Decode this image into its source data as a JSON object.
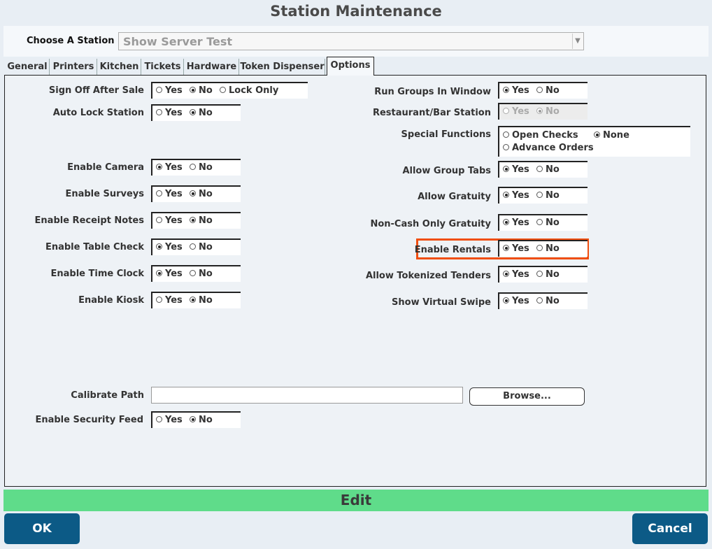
{
  "window": {
    "title": "Station Maintenance"
  },
  "station": {
    "label": "Choose A Station",
    "value": "Show Server Test"
  },
  "tabs": [
    {
      "label": "General"
    },
    {
      "label": "Printers"
    },
    {
      "label": "Kitchen"
    },
    {
      "label": "Tickets"
    },
    {
      "label": "Hardware"
    },
    {
      "label": "Token Dispenser"
    },
    {
      "label": "Options",
      "active": true
    }
  ],
  "left_settings": [
    {
      "label": "Sign Off After Sale",
      "options": [
        "Yes",
        "No",
        "Lock Only"
      ],
      "selected": "No"
    },
    {
      "label": "Auto Lock Station",
      "options": [
        "Yes",
        "No"
      ],
      "selected": "No"
    },
    {
      "label": "Enable Camera",
      "options": [
        "Yes",
        "No"
      ],
      "selected": "Yes"
    },
    {
      "label": "Enable Surveys",
      "options": [
        "Yes",
        "No"
      ],
      "selected": "No"
    },
    {
      "label": "Enable Receipt Notes",
      "options": [
        "Yes",
        "No"
      ],
      "selected": "No"
    },
    {
      "label": "Enable Table Check",
      "options": [
        "Yes",
        "No"
      ],
      "selected": "Yes"
    },
    {
      "label": "Enable Time Clock",
      "options": [
        "Yes",
        "No"
      ],
      "selected": "Yes"
    },
    {
      "label": "Enable Kiosk",
      "options": [
        "Yes",
        "No"
      ],
      "selected": "No"
    }
  ],
  "right_settings": [
    {
      "label": "Run Groups In Window",
      "options": [
        "Yes",
        "No"
      ],
      "selected": "Yes"
    },
    {
      "label": "Restaurant/Bar Station",
      "options": [
        "Yes",
        "No"
      ],
      "selected": "No",
      "disabled": true
    },
    {
      "label": "Special Functions",
      "options": [
        "Open Checks",
        "None",
        "Advance Orders"
      ],
      "selected": "None"
    },
    {
      "label": "Allow Group Tabs",
      "options": [
        "Yes",
        "No"
      ],
      "selected": "Yes"
    },
    {
      "label": "Allow Gratuity",
      "options": [
        "Yes",
        "No"
      ],
      "selected": "Yes"
    },
    {
      "label": "Non-Cash Only Gratuity",
      "options": [
        "Yes",
        "No"
      ],
      "selected": "Yes"
    },
    {
      "label": "Enable Rentals",
      "options": [
        "Yes",
        "No"
      ],
      "selected": "Yes",
      "highlighted": true
    },
    {
      "label": "Allow Tokenized Tenders",
      "options": [
        "Yes",
        "No"
      ],
      "selected": "Yes"
    },
    {
      "label": "Show Virtual Swipe",
      "options": [
        "Yes",
        "No"
      ],
      "selected": "Yes"
    }
  ],
  "calibrate": {
    "label": "Calibrate Path",
    "value": "",
    "browse_label": "Browse..."
  },
  "security_feed": {
    "label": "Enable Security Feed",
    "options": [
      "Yes",
      "No"
    ],
    "selected": "No"
  },
  "mode_bar": {
    "label": "Edit"
  },
  "buttons": {
    "ok": "OK",
    "cancel": "Cancel"
  },
  "colors": {
    "accent_blue": "#0c5a86",
    "edit_green": "#5fdc8a",
    "highlight_orange": "#f04e10"
  }
}
